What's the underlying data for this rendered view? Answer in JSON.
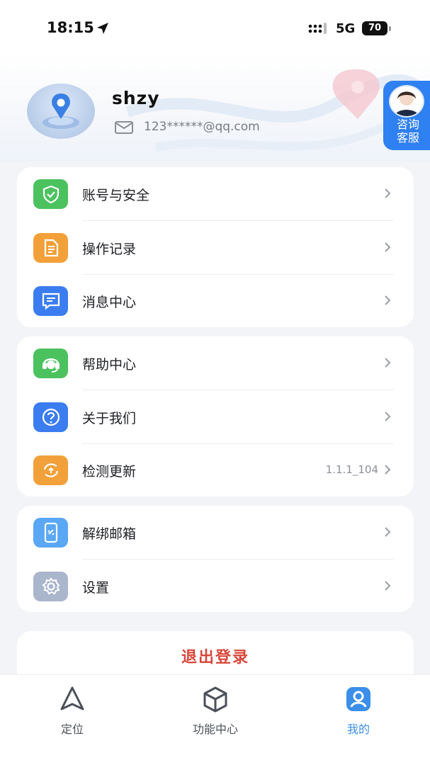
{
  "status_bar": {
    "time": "18:15",
    "network": "5G",
    "battery": "70"
  },
  "profile": {
    "username": "shzy",
    "email": "123******@qq.com"
  },
  "customer_service": {
    "label_line1": "咨询",
    "label_line2": "客服"
  },
  "menu_group_1": [
    {
      "label": "账号与安全",
      "icon": "shield-check-icon",
      "color": "#4cc25f"
    },
    {
      "label": "操作记录",
      "icon": "document-icon",
      "color": "#f2a03a"
    },
    {
      "label": "消息中心",
      "icon": "message-icon",
      "color": "#3b7df0"
    }
  ],
  "menu_group_2": [
    {
      "label": "帮助中心",
      "icon": "headset-icon",
      "color": "#4cc25f"
    },
    {
      "label": "关于我们",
      "icon": "question-icon",
      "color": "#3b7df0"
    },
    {
      "label": "检测更新",
      "icon": "update-icon",
      "color": "#f2a03a",
      "value": "1.1.1_104"
    }
  ],
  "menu_group_3": [
    {
      "label": "解绑邮箱",
      "icon": "unlink-phone-icon",
      "color": "#5aa7f5"
    },
    {
      "label": "设置",
      "icon": "gear-icon",
      "color": "#aab6cc"
    }
  ],
  "logout": {
    "label": "退出登录",
    "color": "#d9463a"
  },
  "tabbar": [
    {
      "label": "定位",
      "icon": "navigation-icon",
      "active": false
    },
    {
      "label": "功能中心",
      "icon": "cube-icon",
      "active": false
    },
    {
      "label": "我的",
      "icon": "profile-icon",
      "active": true
    }
  ]
}
